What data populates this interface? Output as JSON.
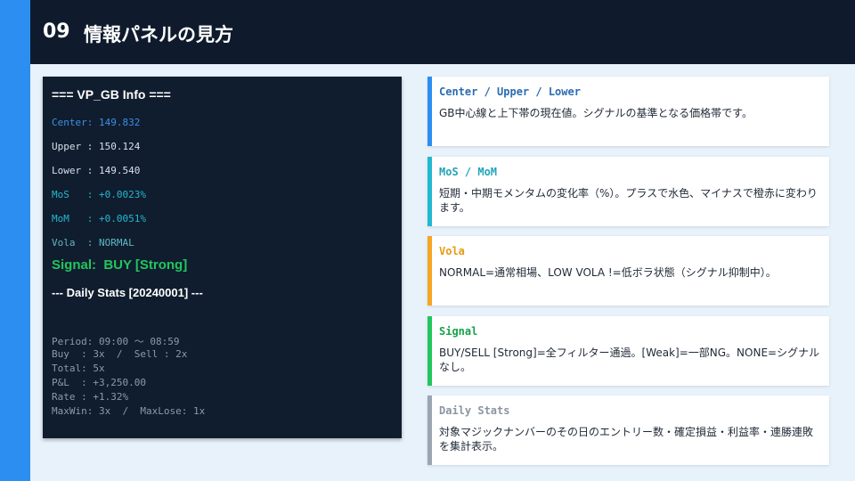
{
  "slide": {
    "number": "09",
    "title": "情報パネルの見方"
  },
  "panel": {
    "header": "=== VP_GB Info ===",
    "lines": [
      {
        "text": "Center: 149.832",
        "color": "#3b8fe8"
      },
      {
        "text": "Upper : 150.124",
        "color": "#d6e0ea"
      },
      {
        "text": "Lower : 149.540",
        "color": "#d6e0ea"
      },
      {
        "text": "MoS   : +0.0023%",
        "color": "#22b8cf"
      },
      {
        "text": "MoM   : +0.0051%",
        "color": "#22b8cf"
      },
      {
        "text": "Vola  : NORMAL",
        "color": "#5fb6c4"
      }
    ],
    "signal": "Signal:  BUY [Strong]",
    "stats_header": "--- Daily Stats [20240001] ---",
    "daily": [
      "Period: 09:00 〜 08:59",
      "Buy  : 3x  /  Sell : 2x",
      "Total: 5x",
      "P&L  : +3,250.00",
      "Rate : +1.32%",
      "MaxWin: 3x  /  MaxLose: 1x"
    ]
  },
  "cards": [
    {
      "title": "Center / Upper / Lower",
      "desc": "GB中心線と上下帯の現在値。シグナルの基準となる価格帯です。",
      "color": "#2b8ef0",
      "title_color": "#2b6cb0"
    },
    {
      "title": "MoS / MoM",
      "desc": "短期・中期モメンタムの変化率（%）。プラスで水色、マイナスで橙赤に変わります。",
      "color": "#22b8cf",
      "title_color": "#22a3b8"
    },
    {
      "title": "Vola",
      "desc": "NORMAL=通常相場、LOW VOLA !=低ボラ状態（シグナル抑制中）。",
      "color": "#f5a623",
      "title_color": "#e89a10"
    },
    {
      "title": "Signal",
      "desc": "BUY/SELL [Strong]=全フィルター通過。[Weak]=一部NG。NONE=シグナルなし。",
      "color": "#22c55e",
      "title_color": "#16a34a"
    },
    {
      "title": "Daily Stats",
      "desc": "対象マジックナンバーのその日のエントリー数・確定損益・利益率・連勝連敗を集計表示。",
      "color": "#9aa5b1",
      "title_color": "#8a96a3"
    }
  ]
}
